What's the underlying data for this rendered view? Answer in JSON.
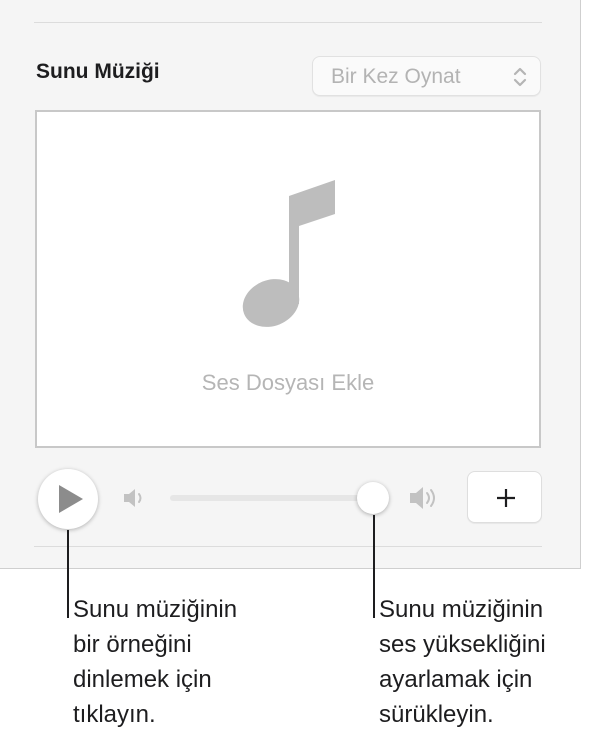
{
  "panel": {
    "title": "Sunu Müziği",
    "playback_mode": {
      "selected": "Bir Kez Oynat",
      "icon": "chevron-up-down-icon"
    },
    "dropzone": {
      "label": "Ses Dosyası Ekle",
      "icon": "music-note-icon"
    },
    "controls": {
      "play_icon": "play-icon",
      "volume_low_icon": "speaker-low-icon",
      "volume_high_icon": "speaker-high-icon",
      "volume_level": 0.99,
      "add_icon": "plus-icon"
    }
  },
  "callouts": {
    "play": {
      "lines": [
        "Sunu müziğinin",
        "bir örneğini",
        "dinlemek için",
        "tıklayın."
      ]
    },
    "volume": {
      "lines": [
        "Sunu müziğinin",
        "ses yüksekliğini",
        "ayarlamak için",
        "sürükleyin."
      ]
    }
  },
  "colors": {
    "panel_bg": "#f5f5f5",
    "placeholder_gray": "#b5b5b5",
    "text": "#1d1d1f"
  }
}
